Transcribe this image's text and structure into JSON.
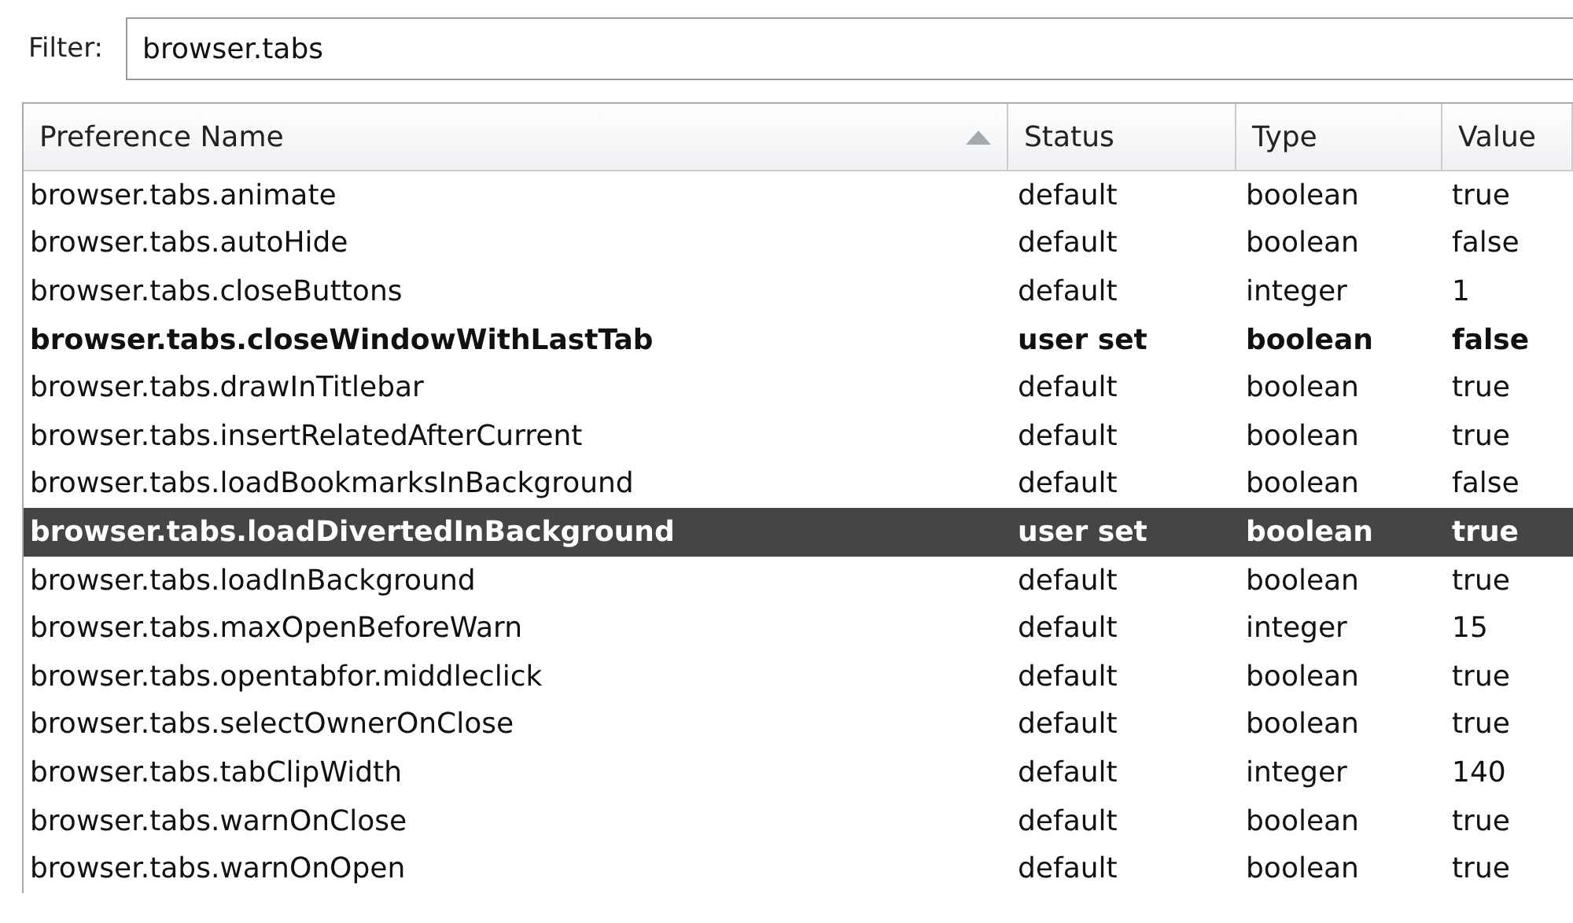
{
  "filter": {
    "label": "Filter:",
    "value": "browser.tabs"
  },
  "table": {
    "columns": [
      {
        "label": "Preference Name",
        "sorted": true
      },
      {
        "label": "Status",
        "sorted": false
      },
      {
        "label": "Type",
        "sorted": false
      },
      {
        "label": "Value",
        "sorted": false
      }
    ],
    "rows": [
      {
        "name": "browser.tabs.animate",
        "status": "default",
        "type": "boolean",
        "value": "true",
        "modified": false,
        "selected": false
      },
      {
        "name": "browser.tabs.autoHide",
        "status": "default",
        "type": "boolean",
        "value": "false",
        "modified": false,
        "selected": false
      },
      {
        "name": "browser.tabs.closeButtons",
        "status": "default",
        "type": "integer",
        "value": "1",
        "modified": false,
        "selected": false
      },
      {
        "name": "browser.tabs.closeWindowWithLastTab",
        "status": "user set",
        "type": "boolean",
        "value": "false",
        "modified": true,
        "selected": false
      },
      {
        "name": "browser.tabs.drawInTitlebar",
        "status": "default",
        "type": "boolean",
        "value": "true",
        "modified": false,
        "selected": false
      },
      {
        "name": "browser.tabs.insertRelatedAfterCurrent",
        "status": "default",
        "type": "boolean",
        "value": "true",
        "modified": false,
        "selected": false
      },
      {
        "name": "browser.tabs.loadBookmarksInBackground",
        "status": "default",
        "type": "boolean",
        "value": "false",
        "modified": false,
        "selected": false
      },
      {
        "name": "browser.tabs.loadDivertedInBackground",
        "status": "user set",
        "type": "boolean",
        "value": "true",
        "modified": true,
        "selected": true
      },
      {
        "name": "browser.tabs.loadInBackground",
        "status": "default",
        "type": "boolean",
        "value": "true",
        "modified": false,
        "selected": false
      },
      {
        "name": "browser.tabs.maxOpenBeforeWarn",
        "status": "default",
        "type": "integer",
        "value": "15",
        "modified": false,
        "selected": false
      },
      {
        "name": "browser.tabs.opentabfor.middleclick",
        "status": "default",
        "type": "boolean",
        "value": "true",
        "modified": false,
        "selected": false
      },
      {
        "name": "browser.tabs.selectOwnerOnClose",
        "status": "default",
        "type": "boolean",
        "value": "true",
        "modified": false,
        "selected": false
      },
      {
        "name": "browser.tabs.tabClipWidth",
        "status": "default",
        "type": "integer",
        "value": "140",
        "modified": false,
        "selected": false
      },
      {
        "name": "browser.tabs.warnOnClose",
        "status": "default",
        "type": "boolean",
        "value": "true",
        "modified": false,
        "selected": false
      },
      {
        "name": "browser.tabs.warnOnOpen",
        "status": "default",
        "type": "boolean",
        "value": "true",
        "modified": false,
        "selected": false
      }
    ]
  }
}
